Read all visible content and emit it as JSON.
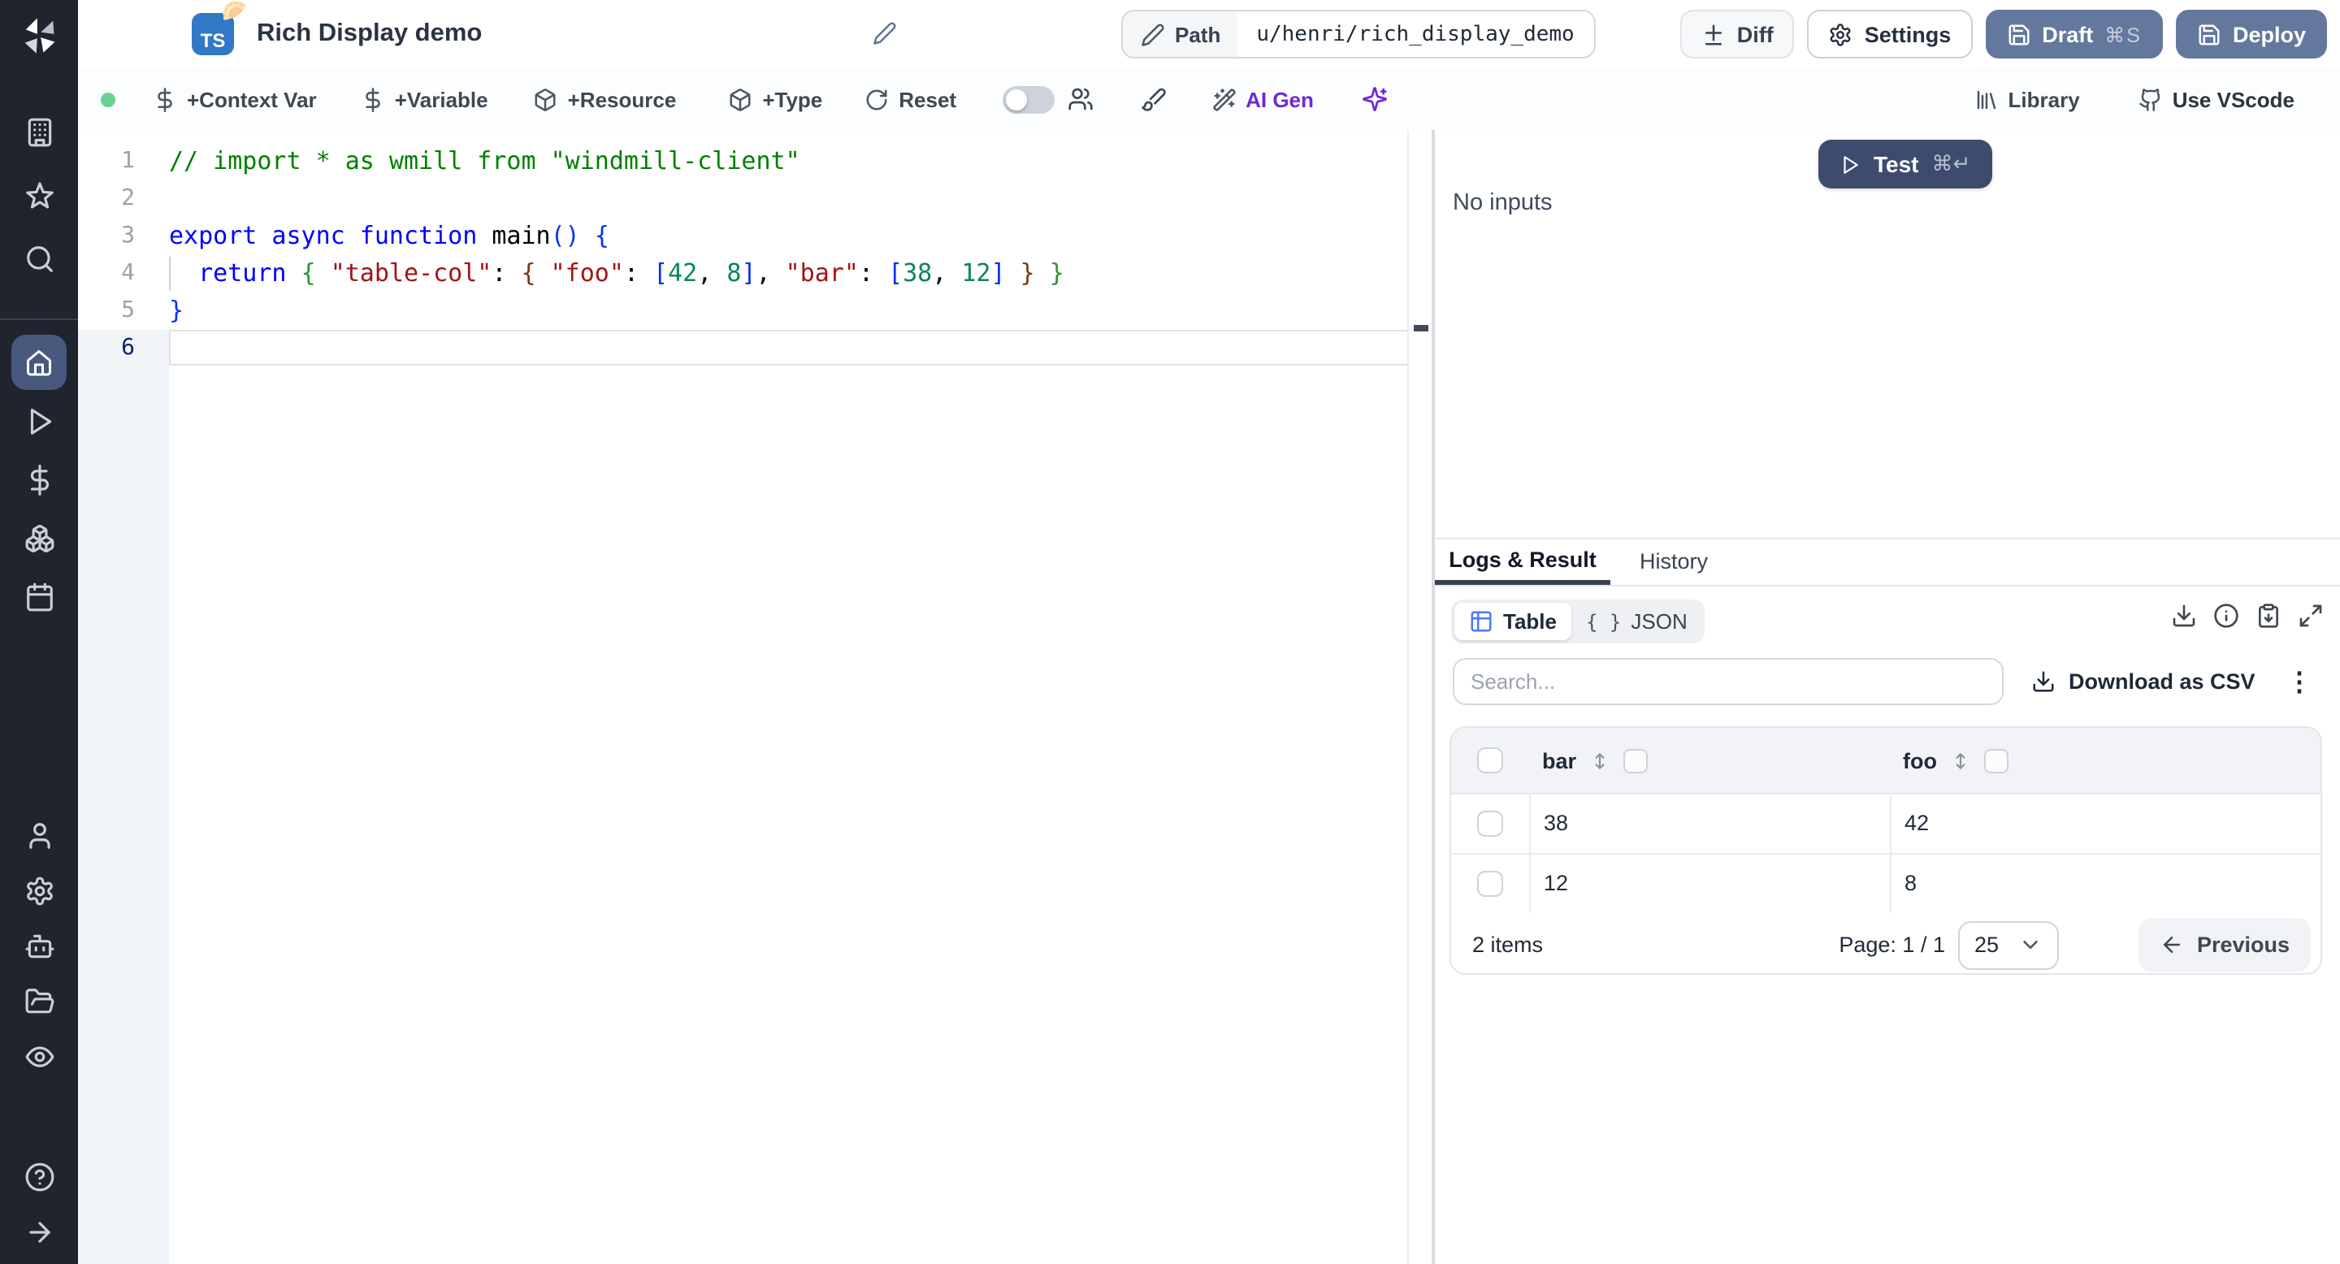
{
  "header": {
    "badge": "TS",
    "emoji": "🥟",
    "title": "Rich Display demo",
    "path_label": "Path",
    "path_value": "u/henri/rich_display_demo",
    "diff": "Diff",
    "settings": "Settings",
    "draft": "Draft",
    "draft_shortcut": "⌘S",
    "deploy": "Deploy"
  },
  "toolbar": {
    "context_var": "+Context Var",
    "variable": "+Variable",
    "resource": "+Resource",
    "type": "+Type",
    "reset": "Reset",
    "ai_gen": "AI Gen",
    "library": "Library",
    "use_vscode": "Use VScode"
  },
  "sidebar": {
    "sections": {
      "top": [
        {
          "icon": "building",
          "name": "workspace"
        },
        {
          "icon": "star",
          "name": "favorites"
        },
        {
          "icon": "search",
          "name": "search"
        }
      ],
      "main": [
        {
          "icon": "home",
          "name": "home",
          "active": true
        },
        {
          "icon": "play",
          "name": "runs"
        },
        {
          "icon": "dollar",
          "name": "variables"
        },
        {
          "icon": "boxes",
          "name": "resources"
        },
        {
          "icon": "calendar",
          "name": "schedules"
        }
      ],
      "lower": [
        {
          "icon": "user",
          "name": "users"
        },
        {
          "icon": "gear",
          "name": "settings"
        },
        {
          "icon": "bot",
          "name": "workers"
        },
        {
          "icon": "folder-open",
          "name": "folders"
        },
        {
          "icon": "eye",
          "name": "audit-logs"
        }
      ],
      "bottom": [
        {
          "icon": "help-circle",
          "name": "help"
        },
        {
          "icon": "arrow-right",
          "name": "expand-sidebar"
        }
      ]
    }
  },
  "editor": {
    "lines": [
      {
        "n": "1",
        "t": [
          [
            "// import * as wmill from \"windmill-client\"",
            "cm"
          ]
        ]
      },
      {
        "n": "2",
        "t": []
      },
      {
        "n": "3",
        "t": [
          [
            "export async function",
            "kw"
          ],
          [
            " main",
            "id"
          ],
          [
            "()",
            "b1"
          ],
          [
            " ",
            "pn"
          ],
          [
            "{",
            "b1"
          ]
        ]
      },
      {
        "n": "4",
        "t": [
          [
            "  ",
            "pn"
          ],
          [
            "return",
            "kw"
          ],
          [
            " ",
            "pn"
          ],
          [
            "{",
            "b2"
          ],
          [
            " ",
            "pn"
          ],
          [
            "\"table-col\"",
            "st"
          ],
          [
            ":",
            "pn"
          ],
          [
            " ",
            "pn"
          ],
          [
            "{",
            "b3"
          ],
          [
            " ",
            "pn"
          ],
          [
            "\"foo\"",
            "st"
          ],
          [
            ":",
            "pn"
          ],
          [
            " ",
            "pn"
          ],
          [
            "[",
            "b1"
          ],
          [
            "42",
            "nu"
          ],
          [
            ",",
            "pn"
          ],
          [
            " ",
            "pn"
          ],
          [
            "8",
            "nu"
          ],
          [
            "]",
            "b1"
          ],
          [
            ",",
            "pn"
          ],
          [
            " ",
            "pn"
          ],
          [
            "\"bar\"",
            "st"
          ],
          [
            ":",
            "pn"
          ],
          [
            " ",
            "pn"
          ],
          [
            "[",
            "b1"
          ],
          [
            "38",
            "nu"
          ],
          [
            ",",
            "pn"
          ],
          [
            " ",
            "pn"
          ],
          [
            "12",
            "nu"
          ],
          [
            "]",
            "b1"
          ],
          [
            " ",
            "pn"
          ],
          [
            "}",
            "b3"
          ],
          [
            " ",
            "pn"
          ],
          [
            "}",
            "b2"
          ]
        ]
      },
      {
        "n": "5",
        "t": [
          [
            "}",
            "b1"
          ]
        ]
      },
      {
        "n": "6",
        "t": [],
        "active": true
      }
    ]
  },
  "run": {
    "test": "Test",
    "shortcut": "⌘↵",
    "no_inputs": "No inputs"
  },
  "result": {
    "tab_logs": "Logs & Result",
    "tab_history": "History",
    "view_table": "Table",
    "view_json": "JSON",
    "json_glyph": "{ }",
    "search_placeholder": "Search...",
    "download_csv": "Download as CSV",
    "kebab": "⋮",
    "table": {
      "columns": [
        "bar",
        "foo"
      ],
      "rows": [
        [
          "38",
          "42"
        ],
        [
          "12",
          "8"
        ]
      ],
      "items_label": "2 items",
      "page_label": "Page: 1 / 1",
      "page_size": "25",
      "previous": "Previous"
    }
  },
  "colors": {
    "sidebar_bg": "#20242e",
    "sidebar_active_bg": "#47597c",
    "primary_button": "#64789d",
    "test_button": "#3d4c6e",
    "ai_purple": "#6d28d9",
    "table_icon_blue": "#4f78f7",
    "status_green": "#68d391",
    "ts_badge_blue": "#3178c6"
  }
}
